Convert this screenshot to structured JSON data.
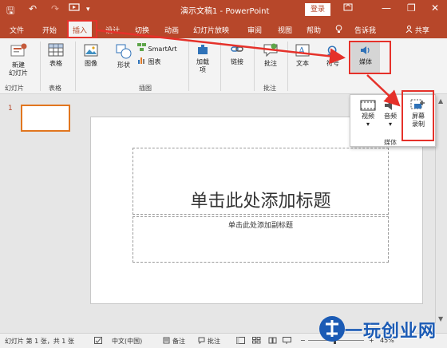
{
  "titlebar": {
    "title": "演示文稿1 - PowerPoint",
    "login": "登录",
    "qa_save": "🖫",
    "qa_undo": "↶",
    "qa_redo": "↷",
    "qa_custom": "▾",
    "minimize": "—",
    "restore": "❐",
    "close": "✕"
  },
  "tabs": [
    {
      "label": "文件"
    },
    {
      "label": "开始"
    },
    {
      "label": "插入"
    },
    {
      "label": "设计"
    },
    {
      "label": "切换"
    },
    {
      "label": "动画"
    },
    {
      "label": "幻灯片放映"
    },
    {
      "label": "审阅"
    },
    {
      "label": "视图"
    },
    {
      "label": "帮助"
    },
    {
      "label": "告诉我"
    }
  ],
  "share": "共享",
  "ribbon": {
    "new_slide": "新建",
    "new_slide2": "幻灯片",
    "table": "表格",
    "image": "图像",
    "shapes": "形状",
    "smartart": "SmartArt",
    "chart": "图表",
    "addins": "加载",
    "addins2": "项",
    "link": "链接",
    "comment": "批注",
    "text": "文本",
    "symbol": "符号",
    "media": "媒体",
    "groups": {
      "slides": "幻灯片",
      "tables": "表格",
      "illustrations": "插图",
      "comments": "批注"
    }
  },
  "dropdown": {
    "video": "视频",
    "audio": "音频",
    "screen_rec1": "屏幕",
    "screen_rec2": "录制",
    "group_label": "媒体"
  },
  "thumbnails": {
    "slide_number": "1"
  },
  "slide": {
    "title_placeholder": "单击此处添加标题",
    "subtitle_placeholder": "单击此处添加副标题"
  },
  "statusbar": {
    "slide_info": "幻灯片 第 1 张，共 1 张",
    "language": "中文(中国)",
    "notes": "备注",
    "comments": "批注",
    "zoom": "45%"
  },
  "watermark": {
    "text": "一玩创业网"
  },
  "colors": {
    "accent": "#b7472a",
    "annotation": "#e5312a",
    "watermark": "#1b5bb5"
  }
}
